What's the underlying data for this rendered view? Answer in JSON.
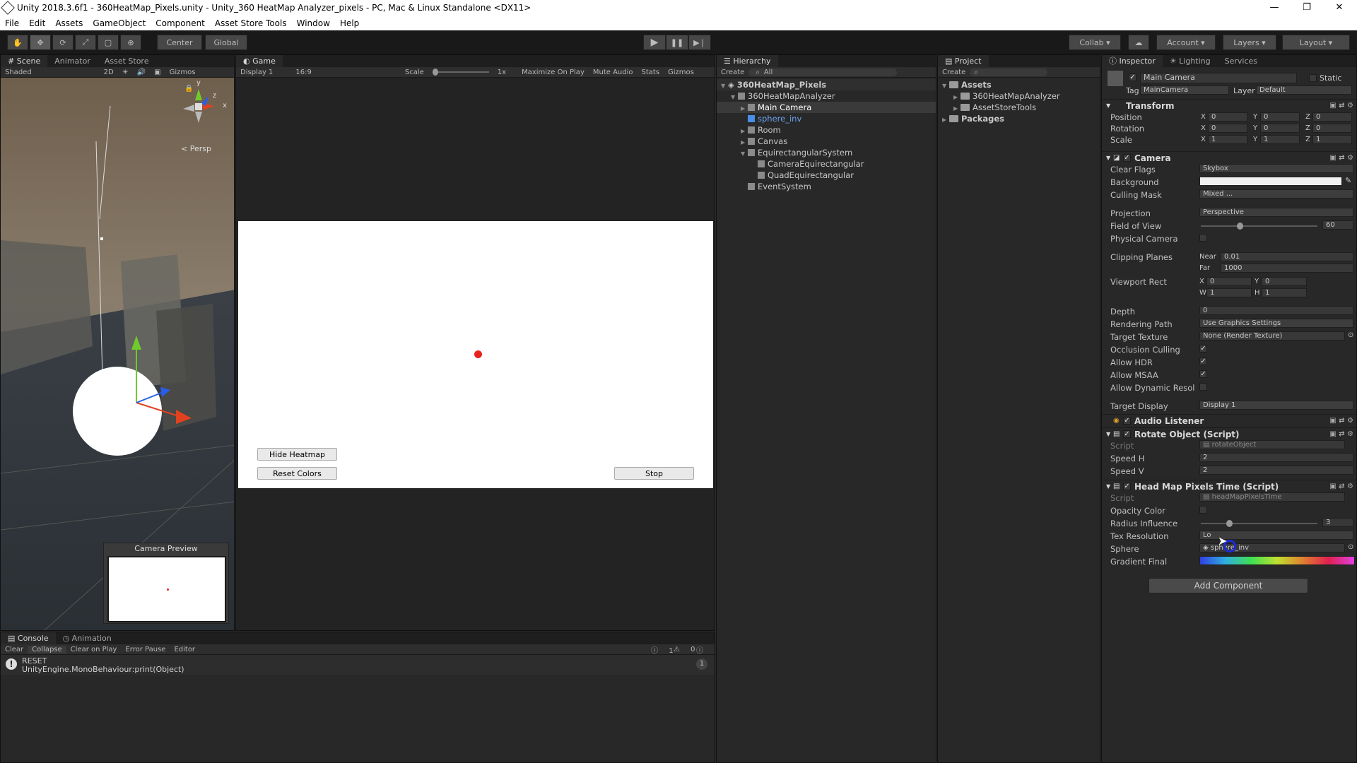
{
  "window": {
    "title": "Unity 2018.3.6f1 - 360HeatMap_Pixels.unity - Unity_360 HeatMap Analyzer_pixels - PC, Mac & Linux Standalone <DX11>",
    "controls": [
      "—",
      "❐",
      "✕"
    ]
  },
  "menu": [
    "File",
    "Edit",
    "Assets",
    "GameObject",
    "Component",
    "Asset Store Tools",
    "Window",
    "Help"
  ],
  "toolbar": {
    "pivot": "Center",
    "space": "Global",
    "collab": "Collab ▾",
    "account": "Account",
    "layers": "Layers",
    "layout": "Layout"
  },
  "scene": {
    "tabs": [
      "Scene",
      "Animator",
      "Asset Store"
    ],
    "shading": "Shaded",
    "mode2d": "2D",
    "gizmos": "Gizmos",
    "persp": "Persp",
    "gizmo_axes": {
      "y": "y",
      "z": "z",
      "x": "x"
    },
    "camera_preview": "Camera Preview"
  },
  "game": {
    "tab": "Game",
    "display": "Display 1",
    "aspect": "16:9",
    "scale_label": "Scale",
    "scale_value": "1x",
    "maximize": "Maximize On Play",
    "mute": "Mute Audio",
    "stats": "Stats",
    "gizmos": "Gizmos",
    "buttons": {
      "hide_heatmap": "Hide Heatmap",
      "reset_colors": "Reset Colors",
      "stop": "Stop"
    }
  },
  "hierarchy": {
    "tab": "Hierarchy",
    "create": "Create",
    "search": "All",
    "scene_name": "360HeatMap_Pixels",
    "items": [
      "360HeatMapAnalyzer",
      "Main Camera",
      "sphere_inv",
      "Room",
      "Canvas",
      "EquirectangularSystem",
      "CameraEquirectangular",
      "QuadEquirectangular",
      "EventSystem"
    ]
  },
  "project": {
    "tab": "Project",
    "create": "Create",
    "items": [
      "Assets",
      "360HeatMapAnalyzer",
      "AssetStoreTools",
      "Packages"
    ]
  },
  "inspector": {
    "tabs": [
      "Inspector",
      "Lighting",
      "Services"
    ],
    "object_name": "Main Camera",
    "static_label": "Static",
    "tag_label": "Tag",
    "tag_value": "MainCamera",
    "layer_label": "Layer",
    "layer_value": "Default",
    "transform": {
      "title": "Transform",
      "rows": [
        {
          "label": "Position",
          "x": "0",
          "y": "0",
          "z": "0"
        },
        {
          "label": "Rotation",
          "x": "0",
          "y": "0",
          "z": "0"
        },
        {
          "label": "Scale",
          "x": "1",
          "y": "1",
          "z": "1"
        }
      ]
    },
    "camera": {
      "title": "Camera",
      "clear_flags": {
        "label": "Clear Flags",
        "value": "Skybox"
      },
      "background": {
        "label": "Background"
      },
      "culling_mask": {
        "label": "Culling Mask",
        "value": "Mixed ..."
      },
      "projection": {
        "label": "Projection",
        "value": "Perspective"
      },
      "fov": {
        "label": "Field of View",
        "value": "60",
        "level": 0.33
      },
      "physical": {
        "label": "Physical Camera"
      },
      "clipping": {
        "label": "Clipping Planes",
        "near_label": "Near",
        "near": "0.01",
        "far_label": "Far",
        "far": "1000"
      },
      "viewport": {
        "label": "Viewport Rect",
        "x": "0",
        "y": "0",
        "w": "1",
        "h": "1"
      },
      "depth": {
        "label": "Depth",
        "value": "0"
      },
      "rendering_path": {
        "label": "Rendering Path",
        "value": "Use Graphics Settings"
      },
      "target_texture": {
        "label": "Target Texture",
        "value": "None (Render Texture)"
      },
      "occlusion": {
        "label": "Occlusion Culling"
      },
      "hdr": {
        "label": "Allow HDR"
      },
      "msaa": {
        "label": "Allow MSAA"
      },
      "dynres": {
        "label": "Allow Dynamic Resol"
      },
      "target_display": {
        "label": "Target Display",
        "value": "Display 1"
      }
    },
    "audio_listener": {
      "title": "Audio Listener"
    },
    "rotate_object": {
      "title": "Rotate Object (Script)",
      "script_label": "Script",
      "script_value": "rotateObject",
      "speed_h_label": "Speed H",
      "speed_h": "2",
      "speed_v_label": "Speed V",
      "speed_v": "2"
    },
    "heatmap": {
      "title": "Head Map Pixels Time (Script)",
      "script_label": "Script",
      "script_value": "headMapPixelsTime",
      "opacity_label": "Opacity Color",
      "radius_label": "Radius Influence",
      "radius_value": "3",
      "radius_level": 0.23,
      "tex_label": "Tex Resolution",
      "tex_value": "Lo",
      "sphere_label": "Sphere",
      "sphere_value": "sphere_inv",
      "gradient_label": "Gradient Final"
    },
    "add_component": "Add Component"
  },
  "console": {
    "tabs": [
      "Console",
      "Animation"
    ],
    "buttons": [
      "Clear",
      "Collapse",
      "Clear on Play",
      "Error Pause",
      "Editor"
    ],
    "counts": {
      "info": "1",
      "warn": "0",
      "error": "0"
    },
    "entry_line1": "RESET",
    "entry_line2": "UnityEngine.MonoBehaviour:print(Object)",
    "entry_count": "1"
  },
  "colors": {
    "accent_blue": "#3b7bd6",
    "heat_dot": "#e8231c",
    "gizmo_green": "#6fcb2c",
    "gizmo_red": "#e0421f",
    "gizmo_blue": "#2a5ee8"
  }
}
